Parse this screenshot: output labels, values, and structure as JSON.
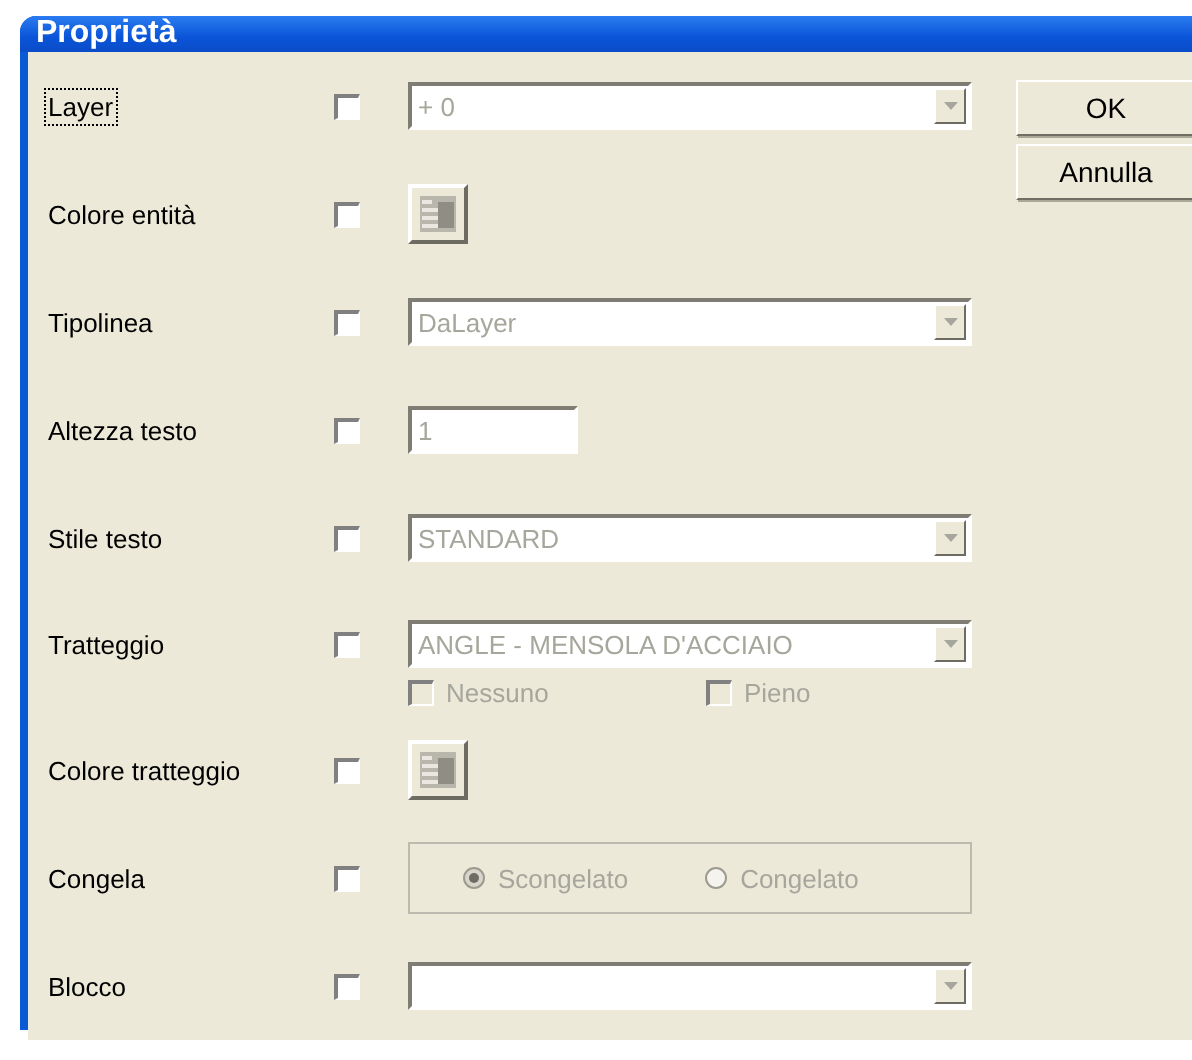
{
  "window": {
    "title": "Proprietà"
  },
  "rows": [
    {
      "label": "Layer",
      "focused": true,
      "checked": false,
      "control": {
        "kind": "combo",
        "value": "+ 0",
        "disabled": true
      }
    },
    {
      "label": "Colore entità",
      "focused": false,
      "checked": false,
      "control": {
        "kind": "color"
      }
    },
    {
      "label": "Tipolinea",
      "focused": false,
      "checked": false,
      "control": {
        "kind": "combo",
        "value": "DaLayer",
        "disabled": true
      }
    },
    {
      "label": "Altezza testo",
      "focused": false,
      "checked": false,
      "control": {
        "kind": "text",
        "value": "1",
        "disabled": true
      }
    },
    {
      "label": "Stile testo",
      "focused": false,
      "checked": false,
      "control": {
        "kind": "combo",
        "value": "STANDARD",
        "disabled": true
      }
    },
    {
      "label": "Tratteggio",
      "focused": false,
      "checked": false,
      "control": {
        "kind": "combo",
        "value": "ANGLE - MENSOLA D'ACCIAIO",
        "disabled": true,
        "options": [
          {
            "label": "Nessuno",
            "checked": false
          },
          {
            "label": "Pieno",
            "checked": false
          }
        ]
      }
    },
    {
      "label": "Colore tratteggio",
      "focused": false,
      "checked": false,
      "control": {
        "kind": "color"
      }
    },
    {
      "label": "Congela",
      "focused": false,
      "checked": false,
      "control": {
        "kind": "radios",
        "options": [
          {
            "label": "Scongelato",
            "selected": true
          },
          {
            "label": "Congelato",
            "selected": false
          }
        ]
      }
    },
    {
      "label": "Blocco",
      "focused": false,
      "checked": false,
      "control": {
        "kind": "combo"
      }
    }
  ],
  "buttons": [
    {
      "label": "OK"
    },
    {
      "label": "Annulla"
    }
  ]
}
